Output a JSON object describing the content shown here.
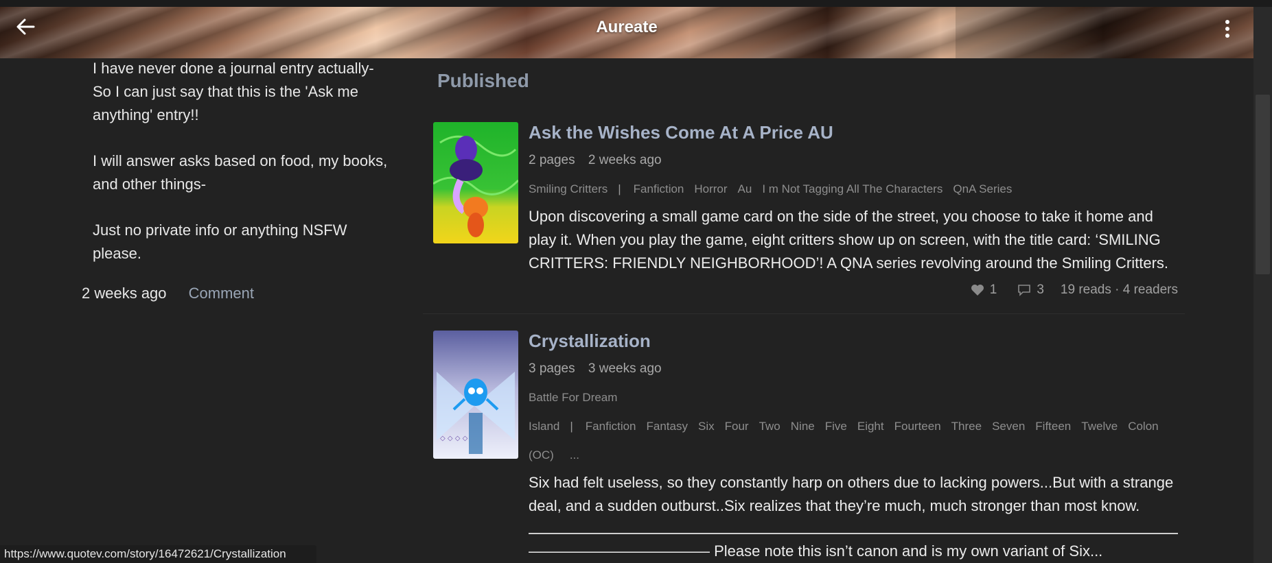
{
  "header": {
    "title": "Aureate"
  },
  "journal": {
    "paragraphs": [
      "I have never done a journal entry actually- So I can just say that this is the 'Ask me anything' entry!!",
      "I will answer asks based on food, my books, and other things-",
      "Just no private info or anything NSFW please."
    ],
    "time": "2 weeks ago",
    "comment_label": "Comment"
  },
  "published": {
    "title": "Published",
    "stories": [
      {
        "title": "Ask the Wishes Come At A Price AU",
        "pages": "2 pages",
        "time": "2 weeks ago",
        "primary_tag": "Smiling Critters",
        "tags": [
          "Fanfiction",
          "Horror",
          "Au",
          "I m Not Tagging All The Characters",
          "QnA Series"
        ],
        "description": "Upon discovering a small game card on the side of the street, you choose to take it home and play it. When you play the game, eight critters show up on screen, with the title card: ‘SMILING CRITTERS: FRIENDLY NEIGHBORHOOD’! A QNA series revolving around the Smiling Critters.",
        "likes": "1",
        "comments": "3",
        "reads": "19 reads · 4 readers"
      },
      {
        "title": "Crystallization",
        "pages": "3 pages",
        "time": "3 weeks ago",
        "primary_tag": "Battle For Dream Island",
        "tags": [
          "Fanfiction",
          "Fantasy",
          "Six",
          "Four",
          "Two",
          "Nine",
          "Five",
          "Eight",
          "Fourteen",
          "Three",
          "Seven",
          "Fifteen",
          "Twelve",
          "Colon (OC)"
        ],
        "more_tags": "...",
        "description": "Six had felt useless, so they constantly harp on others due to lacking powers...But with a strange deal, and a sudden outburst..Six realizes that they’re much, much stronger than most know.",
        "note": "———————————— Please note this isn’t canon and is my own variant of Six..."
      }
    ]
  },
  "statusbar": {
    "url": "https://www.quotev.com/story/16472621/Crystallization"
  }
}
